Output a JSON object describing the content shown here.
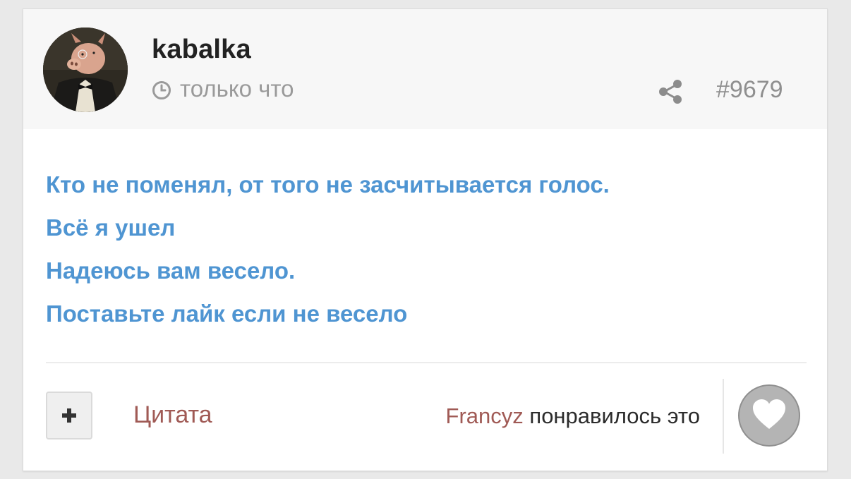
{
  "post": {
    "author": "kabalka",
    "time": "только что",
    "number": "#9679",
    "lines": [
      "Кто не поменял, от того не засчитывается голос.",
      "Всё я ушел",
      "Надеюсь вам весело.",
      "Поставьте лайк если не весело"
    ]
  },
  "footer": {
    "quote_label": "Цитата",
    "liked_by_user": "Francyz",
    "liked_suffix": "понравилось это"
  },
  "icons": {
    "clock": "clock-icon",
    "share": "share-icon",
    "plus": "plus-icon",
    "heart": "heart-icon"
  },
  "colors": {
    "post_text": "#4f95d2",
    "link": "#a05a55",
    "meta_gray": "#9a9a9a",
    "header_bg": "#f7f7f7",
    "heart_bg": "#b4b4b4"
  }
}
